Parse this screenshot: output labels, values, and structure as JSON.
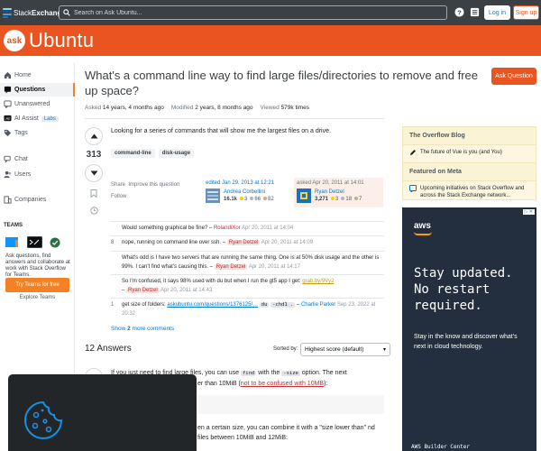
{
  "topbar": {
    "logo_part1": "Stack",
    "logo_part2": "Exchange",
    "search_placeholder": "Search on Ask Ubuntu...",
    "login_label": "Log in",
    "signup_label": "Sign up"
  },
  "site": {
    "logo_badge": "ask",
    "name": "Ubuntu"
  },
  "nav": {
    "home": "Home",
    "questions": "Questions",
    "unanswered": "Unanswered",
    "ai_assist": "AI Assist",
    "labs_badge": "Labs",
    "tags": "Tags",
    "chat": "Chat",
    "users": "Users",
    "companies": "Companies"
  },
  "teams": {
    "title": "TEAMS",
    "description": "Ask questions, find answers and collaborate at work with Stack Overflow for Teams.",
    "cta": "Try Teams for free",
    "explore": "Explore Teams"
  },
  "question": {
    "title": "What's a command line way to find large files/directories to remove and free up space?",
    "ask_button": "Ask Question",
    "asked_label": "Asked",
    "asked_value": "14 years, 4 months ago",
    "modified_label": "Modified",
    "modified_value": "2 years, 8 months ago",
    "viewed_label": "Viewed",
    "viewed_value": "579k times",
    "score": "313",
    "body": "Looking for a series of commands that will show me the largest files on a drive.",
    "tags": [
      "command-line",
      "disk-usage"
    ],
    "actions": {
      "share": "Share",
      "improve": "Improve this question",
      "follow": "Follow"
    },
    "editor": {
      "label": "edited Jan 29, 2013 at 12:21",
      "name": "Andrea Corbellini",
      "rep": "16.1k",
      "gold": "3",
      "silver": "66",
      "bronze": "82"
    },
    "asker": {
      "label": "asked Apr 20, 2011 at 14:01",
      "name": "Ryan Detzel",
      "rep": "3,271",
      "gold": "3",
      "silver": "18",
      "bronze": "7"
    }
  },
  "comments": [
    {
      "score": "",
      "text": "Would something graphical be fine?",
      "user": "RolandiXor",
      "date": "Apr 20, 2011 at 14:04"
    },
    {
      "score": "8",
      "text": "nope, running on command line over ssh.",
      "user": "Ryan Detzel",
      "date": "Apr 20, 2011 at 14:09"
    },
    {
      "score": "",
      "text": "What's odd is I have two servers that are running the same thing. One is at 50% disk usage and the other is 99%. I can't find what's causing this.",
      "user": "Ryan Detzel",
      "date": "Apr 20, 2011 at 14:17"
    },
    {
      "score": "",
      "text": "So I'm confused, it says 98% used with du but when I run the gt5 app I get:",
      "link": "grab.by/9Vy2",
      "user": "Ryan Detzel",
      "date": "Apr 20, 2011 at 14:43"
    },
    {
      "score": "1",
      "text_before": "get size of folders:",
      "link": "askubuntu.com/questions/1376125/…",
      "code1": "du",
      "code2": "-chd1 .",
      "user": "Charlie Parker",
      "date": "Sep 23, 2022 at 20:32"
    }
  ],
  "more_comments": {
    "prefix": "Show",
    "count": "2",
    "suffix": "more comments"
  },
  "answers": {
    "heading": "12 Answers",
    "sort_label": "Sorted by:",
    "sort_value": "Highest score (default)",
    "text1_a": "If you just need to find large files, you can use",
    "text1_code1": "find",
    "text1_b": "with the",
    "text1_code2": "-size",
    "text1_c": "option. The next",
    "text1_line2": "er than 10MiB (",
    "text1_link": "not to be confused with 10MB",
    "text1_end": "):",
    "text2": "en a certain size, you can combine it with a \"size lower than\" nd files between 10MiB and 12MiB:"
  },
  "sidebar": {
    "blog_title": "The Overflow Blog",
    "blog_item": "The future of Vue is you (and You)",
    "meta_title": "Featured on Meta",
    "meta_item": "Upcoming initiatives on Stack Overflow and across the Stack Exchange network..."
  },
  "ad": {
    "brand": "aws",
    "headline": "Stay updated. No restart required.",
    "body": "Stay in the know and discover what's next in cloud technology.",
    "footer": "AWS Builder Center"
  }
}
